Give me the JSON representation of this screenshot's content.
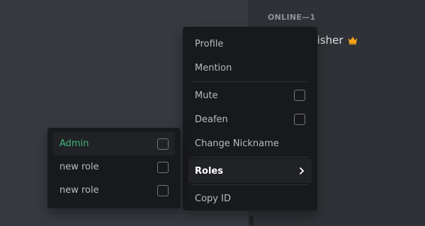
{
  "members": {
    "header": "ONLINE—1",
    "member_name": "tPunisher",
    "owner_icon": "crown-icon"
  },
  "context_menu": {
    "profile": "Profile",
    "mention": "Mention",
    "mute": "Mute",
    "deafen": "Deafen",
    "change_nickname": "Change Nickname",
    "roles": "Roles",
    "copy_id": "Copy ID"
  },
  "roles_submenu": {
    "items": [
      {
        "label": "Admin",
        "color": "#43b581",
        "checked": false
      },
      {
        "label": "new role",
        "checked": false
      },
      {
        "label": "new role",
        "checked": false
      }
    ]
  },
  "colors": {
    "background": "#36393f",
    "sidebar": "#2f3136",
    "menu": "#18191c",
    "accent_admin": "#43b581",
    "crown": "#faa61a"
  }
}
